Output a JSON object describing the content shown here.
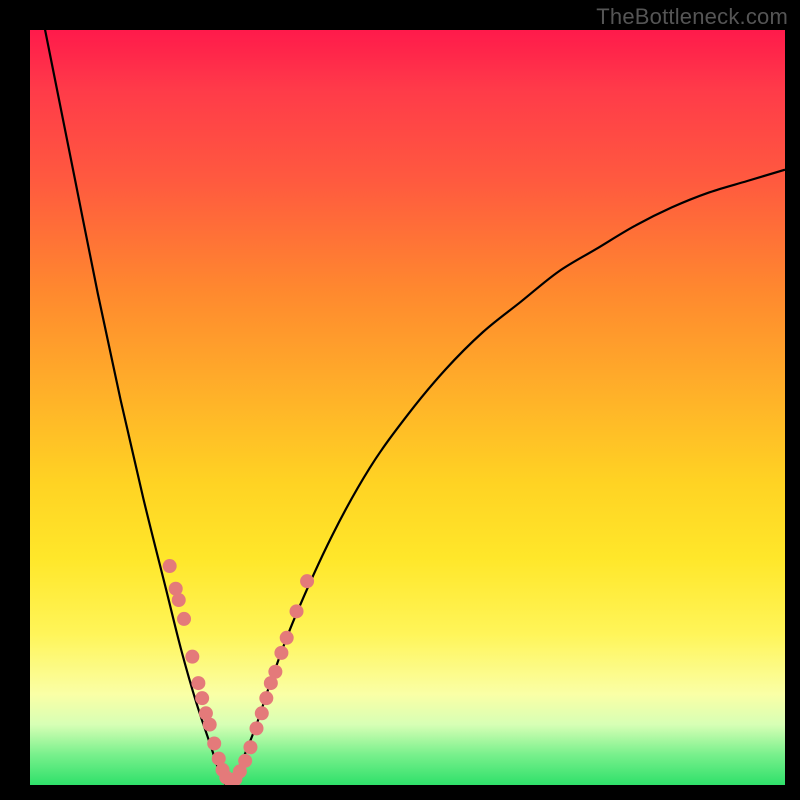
{
  "watermark": {
    "text": "TheBottleneck.com"
  },
  "colors": {
    "frame": "#000000",
    "curve": "#000000",
    "marker_fill": "#e47a7a",
    "marker_stroke": "#d46565"
  },
  "chart_data": {
    "type": "line",
    "title": "",
    "xlabel": "",
    "ylabel": "",
    "xlim": [
      0,
      100
    ],
    "ylim": [
      0,
      100
    ],
    "grid": false,
    "legend": false,
    "note": "Values estimated from pixel positions; y is bottleneck percentage (0 = bottom / green / ideal, 100 = top / red)",
    "series": [
      {
        "name": "bottleneck-curve",
        "x": [
          0,
          3,
          6,
          9,
          12,
          15,
          18,
          20,
          22,
          24,
          25,
          26,
          27,
          28,
          30,
          32,
          35,
          40,
          45,
          50,
          55,
          60,
          65,
          70,
          75,
          80,
          85,
          90,
          95,
          100
        ],
        "y": [
          110,
          95,
          80,
          65,
          51,
          38,
          26,
          18,
          11,
          5,
          2,
          0,
          1,
          3,
          8,
          14,
          22,
          33,
          42,
          49,
          55,
          60,
          64,
          68,
          71,
          74,
          76.5,
          78.5,
          80,
          81.5
        ]
      }
    ],
    "markers": {
      "note": "Salmon-colored data points clustered near the valley of the curve",
      "points": [
        {
          "x": 18.5,
          "y": 29
        },
        {
          "x": 19.3,
          "y": 26
        },
        {
          "x": 19.7,
          "y": 24.5
        },
        {
          "x": 20.4,
          "y": 22
        },
        {
          "x": 21.5,
          "y": 17
        },
        {
          "x": 22.3,
          "y": 13.5
        },
        {
          "x": 22.8,
          "y": 11.5
        },
        {
          "x": 23.3,
          "y": 9.5
        },
        {
          "x": 23.8,
          "y": 8
        },
        {
          "x": 24.4,
          "y": 5.5
        },
        {
          "x": 25.0,
          "y": 3.5
        },
        {
          "x": 25.5,
          "y": 2
        },
        {
          "x": 26.0,
          "y": 1
        },
        {
          "x": 26.6,
          "y": 0.5
        },
        {
          "x": 27.2,
          "y": 0.8
        },
        {
          "x": 27.8,
          "y": 1.8
        },
        {
          "x": 28.5,
          "y": 3.2
        },
        {
          "x": 29.2,
          "y": 5
        },
        {
          "x": 30.0,
          "y": 7.5
        },
        {
          "x": 30.7,
          "y": 9.5
        },
        {
          "x": 31.3,
          "y": 11.5
        },
        {
          "x": 31.9,
          "y": 13.5
        },
        {
          "x": 32.5,
          "y": 15
        },
        {
          "x": 33.3,
          "y": 17.5
        },
        {
          "x": 34.0,
          "y": 19.5
        },
        {
          "x": 35.3,
          "y": 23
        },
        {
          "x": 36.7,
          "y": 27
        }
      ]
    }
  }
}
